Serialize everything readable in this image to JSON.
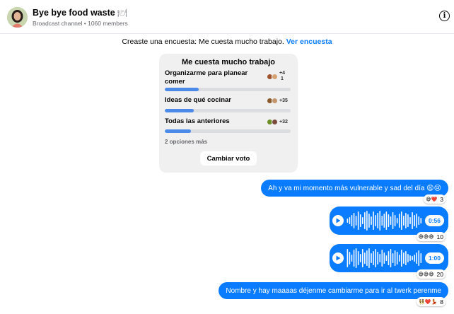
{
  "header": {
    "title": "Bye bye food waste",
    "title_emoji": "🍽",
    "subtitle": "Broadcast channel • 1060 members"
  },
  "system_message": {
    "text": "Creaste una encuesta: Me cuesta mucho trabajo.",
    "link": "Ver encuesta"
  },
  "poll": {
    "title": "Me cuesta mucho trabajo",
    "options": [
      {
        "label": "Organizarme para planear comer",
        "votes_label": "+4\n1",
        "fill": 0.27
      },
      {
        "label": "Ideas de qué cocinar",
        "votes_label": "+35",
        "fill": 0.23
      },
      {
        "label": "Todas las anteriores",
        "votes_label": "+32",
        "fill": 0.21
      }
    ],
    "more_options": "2 opciones más",
    "vote_button": "Cambiar voto"
  },
  "messages": [
    {
      "type": "text",
      "text": "Ah y va mi momento más vulnerable y sad del día 😩😢",
      "reactions": "😅❤️",
      "count": "3"
    },
    {
      "type": "voice",
      "duration": "0:56",
      "reactions": "😅😅😅",
      "count": "10"
    },
    {
      "type": "voice",
      "duration": "1:00",
      "reactions": "😅😅😅",
      "count": "20"
    },
    {
      "type": "text",
      "text": "Nombre y hay maaaas déjenme cambiarme para ir al twerk perenme",
      "reactions": "👯❤️💃",
      "count": "8"
    }
  ],
  "colors": {
    "accent": "#0a7cff",
    "poll_bar": "#4b8ae8",
    "poll_bg": "#f0f0f0"
  }
}
